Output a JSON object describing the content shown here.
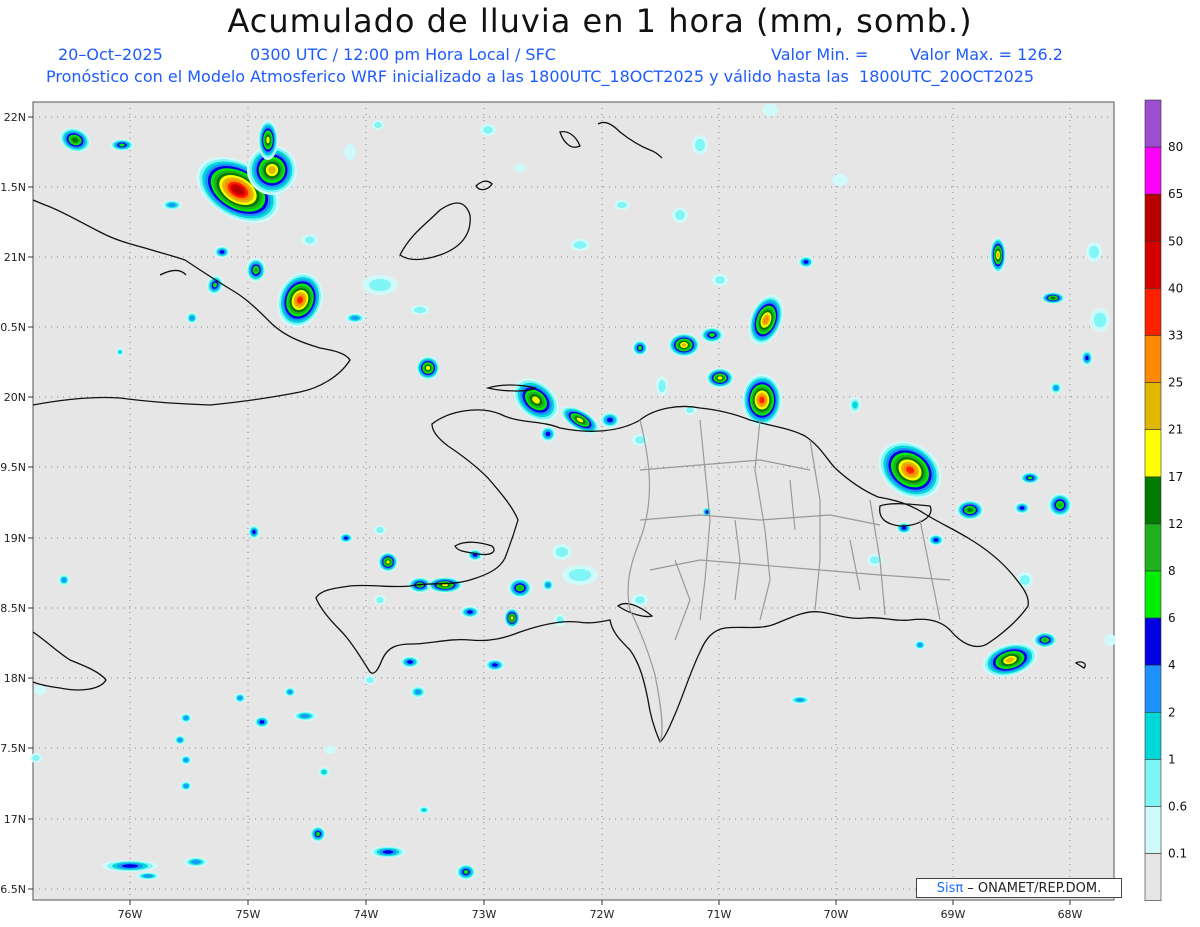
{
  "title": "Acumulado de lluvia en 1 hora (mm, somb.)",
  "subtitle": {
    "date": "20–Oct–2025",
    "time": "0300 UTC / 12:00 pm Hora Local / SFC",
    "min_label": "Valor Min. =",
    "max_label": "Valor Max. = 126.2",
    "model_line": "Pronóstico con el Modelo Atmosferico WRF inicializado a las 1800UTC_18OCT2025 y válido hasta las  1800UTC_20OCT2025"
  },
  "axes": {
    "lon_labels": [
      "76W",
      "75W",
      "74W",
      "73W",
      "72W",
      "71W",
      "70W",
      "69W",
      "68W"
    ],
    "lat_labels": [
      "22N",
      "1.5N",
      "21N",
      "0.5N",
      "20N",
      "9.5N",
      "19N",
      "8.5N",
      "18N",
      "7.5N",
      "17N",
      "6.5N"
    ]
  },
  "colorbar": {
    "labels": [
      "80",
      "65",
      "50",
      "40",
      "33",
      "25",
      "21",
      "17",
      "12",
      "8",
      "6",
      "4",
      "2",
      "1",
      "0.6",
      "0.1"
    ],
    "colors": [
      "#9b4fd0",
      "#ff00ff",
      "#b80000",
      "#d40000",
      "#ff2000",
      "#ff8a00",
      "#e0b800",
      "#ffff00",
      "#007a00",
      "#1fb01f",
      "#00ee00",
      "#0000e0",
      "#1e90ff",
      "#00d8d8",
      "#7ff5f5",
      "#d0fafa",
      "#e6e6e6"
    ]
  },
  "credit": {
    "logo": "Sisπ",
    "text": "– ONAMET/REP.DOM."
  }
}
